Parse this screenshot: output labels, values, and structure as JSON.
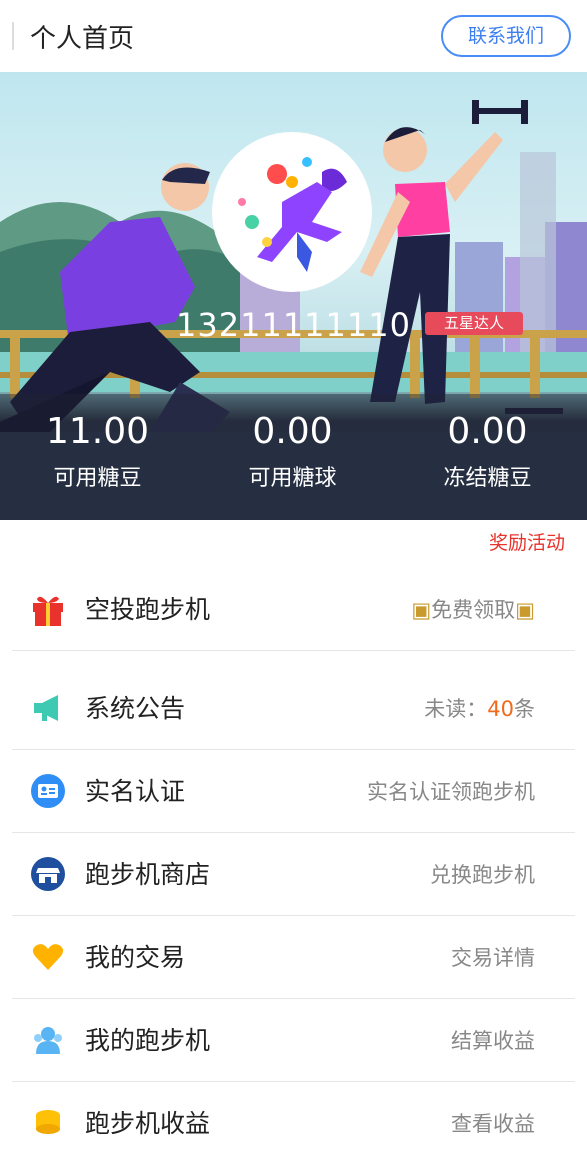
{
  "header": {
    "title": "个人首页",
    "contact_label": "联系我们"
  },
  "profile": {
    "phone": "13211111110",
    "level_badge": "五星达人"
  },
  "stats": [
    {
      "value": "11.00",
      "label": "可用糖豆"
    },
    {
      "value": "0.00",
      "label": "可用糖球"
    },
    {
      "value": "0.00",
      "label": "冻结糖豆"
    }
  ],
  "reward_link": "奖励活动",
  "menu": [
    {
      "label": "空投跑步机",
      "right": "免费领取",
      "icon": "gift-icon",
      "color": "#e8322b"
    },
    {
      "label": "系统公告",
      "right_prefix": "未读：",
      "unread_count": "40",
      "right_suffix": "条",
      "icon": "megaphone-icon",
      "color": "#3ec9b3"
    },
    {
      "label": "实名认证",
      "right": "实名认证领跑步机",
      "icon": "id-card-icon",
      "color": "#2f8ef5"
    },
    {
      "label": "跑步机商店",
      "right": "兑换跑步机",
      "icon": "store-icon",
      "color": "#1f4f9e"
    },
    {
      "label": "我的交易",
      "right": "交易详情",
      "icon": "heart-icon",
      "color": "#ffb300"
    },
    {
      "label": "我的跑步机",
      "right": "结算收益",
      "icon": "users-icon",
      "color": "#58b4f2"
    },
    {
      "label": "跑步机收益",
      "right": "查看收益",
      "icon": "coins-icon",
      "color": "#ffc107"
    }
  ]
}
